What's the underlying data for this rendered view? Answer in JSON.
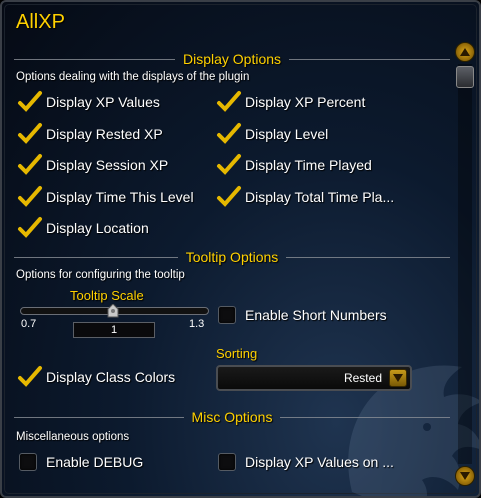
{
  "window": {
    "title": "AllXP"
  },
  "sections": {
    "display": {
      "header": "Display Options",
      "description": "Options dealing with the displays of the plugin",
      "options": [
        {
          "label": "Display XP Values",
          "checked": true
        },
        {
          "label": "Display XP Percent",
          "checked": true
        },
        {
          "label": "Display Rested XP",
          "checked": true
        },
        {
          "label": "Display Level",
          "checked": true
        },
        {
          "label": "Display Session XP",
          "checked": true
        },
        {
          "label": "Display Time Played",
          "checked": true
        },
        {
          "label": "Display Time This Level",
          "checked": true
        },
        {
          "label": "Display Total Time Pla...",
          "checked": true
        },
        {
          "label": "Display Location",
          "checked": true
        }
      ]
    },
    "tooltip": {
      "header": "Tooltip Options",
      "description": "Options for configuring the tooltip",
      "scale": {
        "label": "Tooltip Scale",
        "min": "0.7",
        "max": "1.3",
        "value": "1"
      },
      "short_numbers": {
        "label": "Enable Short Numbers",
        "checked": false
      },
      "class_colors": {
        "label": "Display Class Colors",
        "checked": true
      },
      "sorting": {
        "label": "Sorting",
        "selected": "Rested"
      }
    },
    "misc": {
      "header": "Misc Options",
      "description": "Miscellaneous options",
      "options": [
        {
          "label": "Enable DEBUG",
          "checked": false
        },
        {
          "label": "Display XP Values on ...",
          "checked": false
        }
      ]
    }
  },
  "colors": {
    "accent": "#ffd100",
    "text": "#ffffff",
    "check": "#e6b800"
  },
  "icons": {
    "scroll_up": "arrow-up-icon",
    "scroll_down": "arrow-down-icon",
    "dropdown": "chevron-down-icon",
    "checkmark": "checkmark-icon",
    "watermark": "lion-head-icon"
  }
}
